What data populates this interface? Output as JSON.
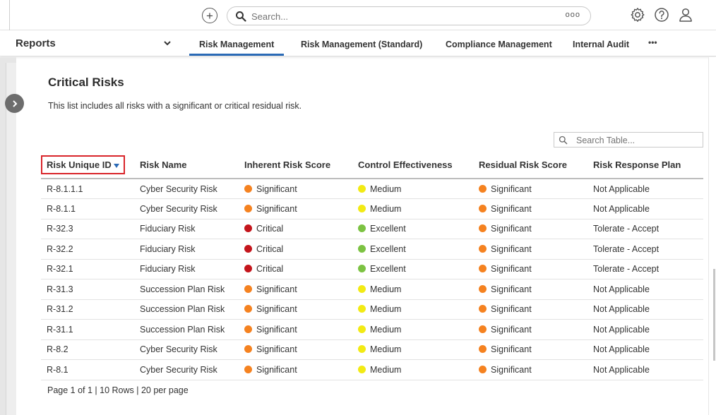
{
  "colors": {
    "accent": "#2a6ab6",
    "highlight_border": "#d9252a",
    "dot_orange": "#f58220",
    "dot_red": "#c4151c",
    "dot_yellow": "#f2ea14",
    "dot_green": "#7cc242"
  },
  "topbar": {
    "add_icon": "plus-circle-icon",
    "search_placeholder": "Search...",
    "search_more": "ooo",
    "icons": [
      "gear-icon",
      "help-icon",
      "user-icon"
    ]
  },
  "nav": {
    "reports_label": "Reports",
    "tabs": [
      {
        "label": "Risk Management",
        "active": true
      },
      {
        "label": "Risk Management (Standard)",
        "active": false
      },
      {
        "label": "Compliance Management",
        "active": false
      },
      {
        "label": "Internal Audit",
        "active": false
      }
    ],
    "more_label": "•••"
  },
  "report": {
    "title": "Critical Risks",
    "description": "This list includes all risks with a significant or critical residual risk.",
    "table_search_placeholder": "Search Table...",
    "pager": "Page 1 of 1 | 10 Rows | 20 per page"
  },
  "table": {
    "headers": [
      "Risk Unique ID",
      "Risk Name",
      "Inherent Risk Score",
      "Control Effectiveness",
      "Residual Risk Score",
      "Risk Response Plan"
    ],
    "sorted_column": "Risk Unique ID",
    "rows": [
      {
        "id": "R-8.1.1.1",
        "name": "Cyber Security Risk",
        "inherent": "Significant",
        "inherent_color": "orange",
        "control": "Medium",
        "control_color": "yellow",
        "residual": "Significant",
        "residual_color": "orange",
        "plan": "Not Applicable"
      },
      {
        "id": "R-8.1.1",
        "name": "Cyber Security Risk",
        "inherent": "Significant",
        "inherent_color": "orange",
        "control": "Medium",
        "control_color": "yellow",
        "residual": "Significant",
        "residual_color": "orange",
        "plan": "Not Applicable"
      },
      {
        "id": "R-32.3",
        "name": "Fiduciary Risk",
        "inherent": "Critical",
        "inherent_color": "red",
        "control": "Excellent",
        "control_color": "green",
        "residual": "Significant",
        "residual_color": "orange",
        "plan": "Tolerate - Accept"
      },
      {
        "id": "R-32.2",
        "name": "Fiduciary Risk",
        "inherent": "Critical",
        "inherent_color": "red",
        "control": "Excellent",
        "control_color": "green",
        "residual": "Significant",
        "residual_color": "orange",
        "plan": "Tolerate - Accept"
      },
      {
        "id": "R-32.1",
        "name": "Fiduciary Risk",
        "inherent": "Critical",
        "inherent_color": "red",
        "control": "Excellent",
        "control_color": "green",
        "residual": "Significant",
        "residual_color": "orange",
        "plan": "Tolerate - Accept"
      },
      {
        "id": "R-31.3",
        "name": "Succession Plan Risk",
        "inherent": "Significant",
        "inherent_color": "orange",
        "control": "Medium",
        "control_color": "yellow",
        "residual": "Significant",
        "residual_color": "orange",
        "plan": "Not Applicable"
      },
      {
        "id": "R-31.2",
        "name": "Succession Plan Risk",
        "inherent": "Significant",
        "inherent_color": "orange",
        "control": "Medium",
        "control_color": "yellow",
        "residual": "Significant",
        "residual_color": "orange",
        "plan": "Not Applicable"
      },
      {
        "id": "R-31.1",
        "name": "Succession Plan Risk",
        "inherent": "Significant",
        "inherent_color": "orange",
        "control": "Medium",
        "control_color": "yellow",
        "residual": "Significant",
        "residual_color": "orange",
        "plan": "Not Applicable"
      },
      {
        "id": "R-8.2",
        "name": "Cyber Security Risk",
        "inherent": "Significant",
        "inherent_color": "orange",
        "control": "Medium",
        "control_color": "yellow",
        "residual": "Significant",
        "residual_color": "orange",
        "plan": "Not Applicable"
      },
      {
        "id": "R-8.1",
        "name": "Cyber Security Risk",
        "inherent": "Significant",
        "inherent_color": "orange",
        "control": "Medium",
        "control_color": "yellow",
        "residual": "Significant",
        "residual_color": "orange",
        "plan": "Not Applicable"
      }
    ]
  }
}
